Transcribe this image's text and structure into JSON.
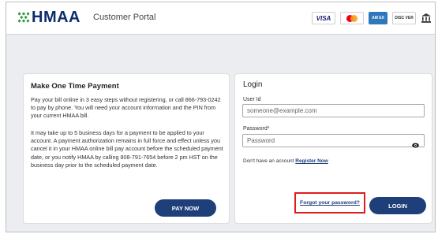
{
  "header": {
    "logo_text": "HMAA",
    "portal_title": "Customer Portal",
    "cards": {
      "visa": "VISA",
      "amex": "AM EX",
      "discover": "DISC VER"
    },
    "bank_icon": "bank-icon"
  },
  "payment": {
    "title": "Make One Time Payment",
    "paragraph1": "Pay your bill online in 3 easy steps without registering, or call 866-793-0242 to pay by phone. You will need your account information and the PIN from your current HMAA bill.",
    "paragraph2": "It may take up to 5 business days for a payment to be applied to your account. A payment authorization remains in full force and effect unless you cancel it in your HMAA online bill pay account before the scheduled payment date, or you notify HMAA by calling 808-791-7654 before 2 pm HST on the business day prior to the scheduled payment date.",
    "pay_button": "PAY NOW"
  },
  "login": {
    "title": "Login",
    "user_label": "User Id",
    "user_placeholder": "someone@example.com",
    "password_label": "Password*",
    "password_placeholder": "Password",
    "no_account_text": "Don't have an account",
    "register_link": "Register Now",
    "forgot_link": "Forgot your password?",
    "login_button": "LOGIN"
  },
  "colors": {
    "brand_navy": "#1f3f7a",
    "highlight_red": "#e01c1c",
    "background": "#ecedf1"
  }
}
